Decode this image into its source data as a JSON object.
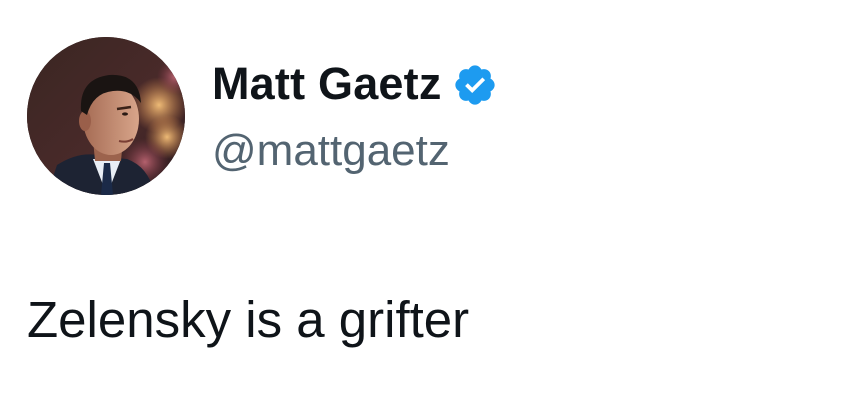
{
  "author": {
    "display_name": "Matt Gaetz",
    "handle": "@mattgaetz",
    "verified": true,
    "avatar_icon": "profile-photo",
    "badge_icon": "verified-badge-icon"
  },
  "tweet": {
    "text": "Zelensky is a grifter"
  },
  "colors": {
    "text_primary": "#0f1419",
    "text_secondary": "#536471",
    "verified_blue": "#1d9bf0",
    "background": "#ffffff"
  }
}
